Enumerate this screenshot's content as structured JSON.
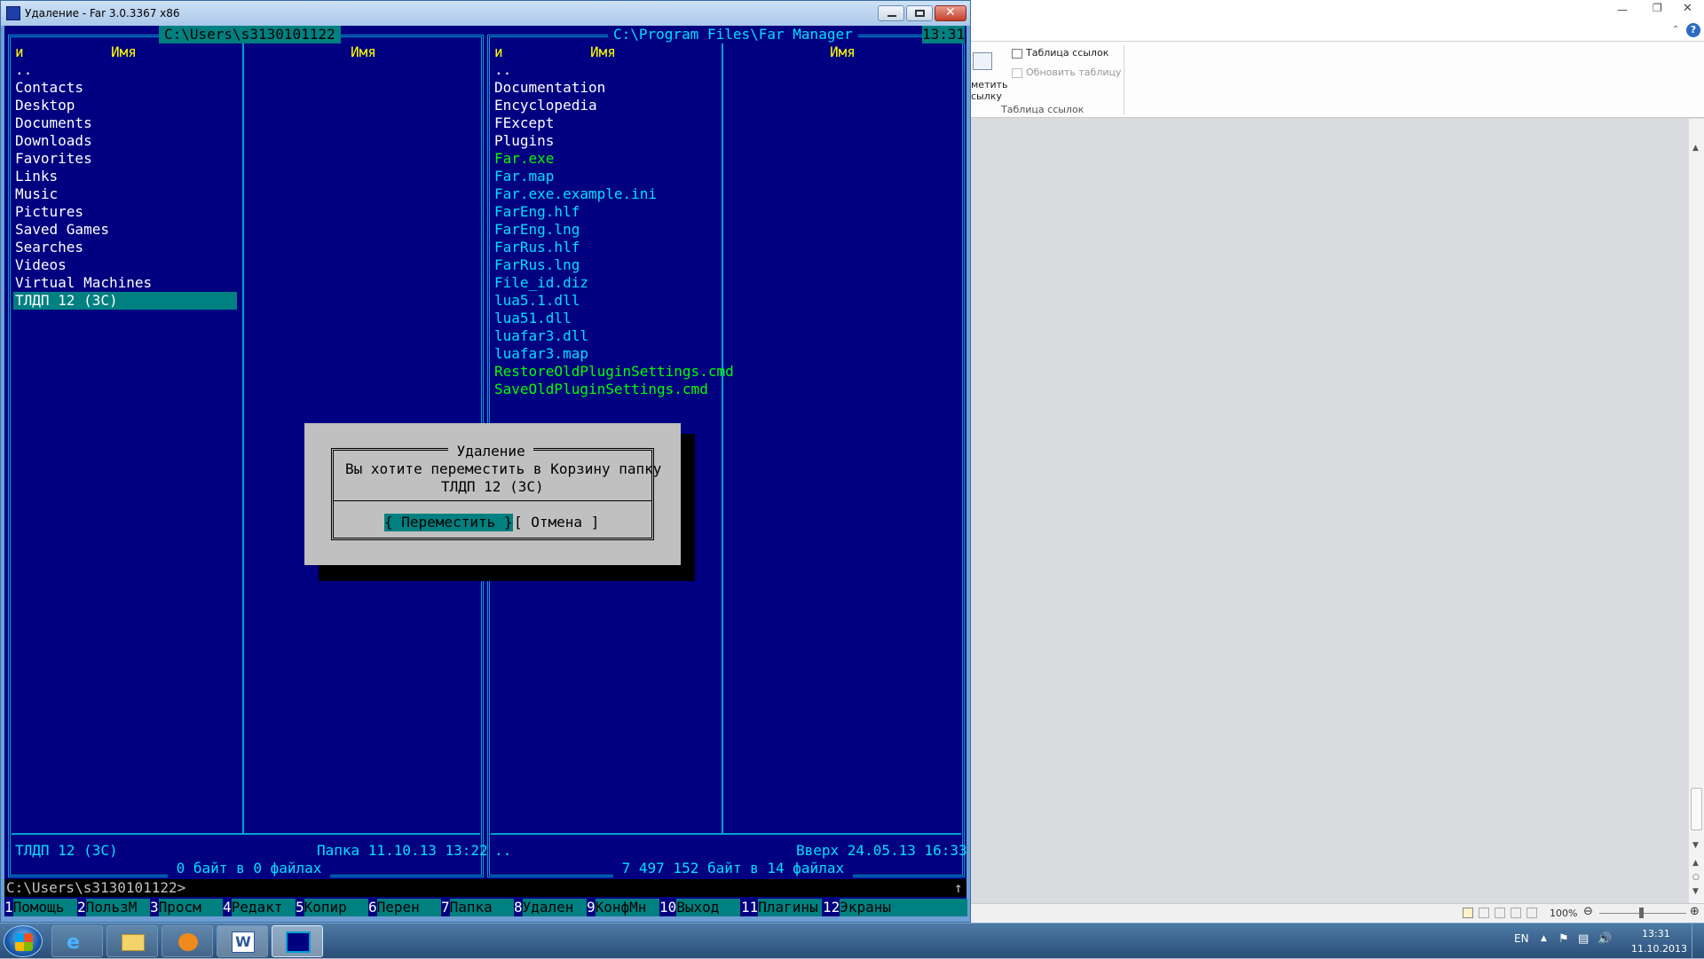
{
  "far": {
    "window_title": "Удаление - Far 3.0.3367 x86",
    "left_path": "C:\\Users\\s3130101122",
    "right_path": "C:\\Program Files\\Far Manager",
    "clock": "13:31",
    "col_left_short": "и",
    "col_name": "Имя",
    "left_files": [
      "..",
      "Contacts",
      "Desktop",
      "Documents",
      "Downloads",
      "Favorites",
      "Links",
      "Music",
      "Pictures",
      "Saved Games",
      "Searches",
      "Videos",
      "Virtual Machines",
      "ТЛДП 12 (3С)"
    ],
    "right_files": [
      {
        "name": "..",
        "kind": "dir"
      },
      {
        "name": "Documentation",
        "kind": "dir"
      },
      {
        "name": "Encyclopedia",
        "kind": "dir"
      },
      {
        "name": "FExcept",
        "kind": "dir"
      },
      {
        "name": "Plugins",
        "kind": "dir"
      },
      {
        "name": "Far.exe",
        "kind": "exe"
      },
      {
        "name": "Far.map",
        "kind": "file"
      },
      {
        "name": "Far.exe.example.ini",
        "kind": "file"
      },
      {
        "name": "FarEng.hlf",
        "kind": "file"
      },
      {
        "name": "FarEng.lng",
        "kind": "file"
      },
      {
        "name": "FarRus.hlf",
        "kind": "file"
      },
      {
        "name": "FarRus.lng",
        "kind": "file"
      },
      {
        "name": "File_id.diz",
        "kind": "file"
      },
      {
        "name": "lua5.1.dll",
        "kind": "file"
      },
      {
        "name": "lua51.dll",
        "kind": "file"
      },
      {
        "name": "luafar3.dll",
        "kind": "file"
      },
      {
        "name": "luafar3.map",
        "kind": "file"
      },
      {
        "name": "RestoreOldPluginSettings.cmd",
        "kind": "exe"
      },
      {
        "name": "SaveOldPluginSettings.cmd",
        "kind": "exe"
      }
    ],
    "left_status_name": "ТЛДП 12 (3С)",
    "left_status_info": "Папка 11.10.13 13:22",
    "left_summary": " 0 байт в 0 файлах ",
    "right_status_name": "..",
    "right_status_info": "Вверх 24.05.13 16:33",
    "right_summary": " 7 497 152 байт в 14 файлах ",
    "command_line": "C:\\Users\\s3130101122>",
    "scroll_arrow": "↑",
    "dialog": {
      "title": " Удаление ",
      "message_line1": "Вы хотите переместить в Корзину папку",
      "message_line2": "ТЛДП 12 (3С)",
      "button_move": "{ Переместить }",
      "button_cancel": "[ Отмена ]"
    },
    "keybar": [
      {
        "num": "1",
        "label": "Помощь"
      },
      {
        "num": "2",
        "label": "ПользМ"
      },
      {
        "num": "3",
        "label": "Просм"
      },
      {
        "num": "4",
        "label": "Редакт"
      },
      {
        "num": "5",
        "label": "Копир"
      },
      {
        "num": "6",
        "label": "Перен"
      },
      {
        "num": "7",
        "label": "Папка"
      },
      {
        "num": "8",
        "label": "Удален"
      },
      {
        "num": "9",
        "label": "КонфМн"
      },
      {
        "num": "10",
        "label": "Выход"
      },
      {
        "num": "11",
        "label": "Плагины"
      },
      {
        "num": "12",
        "label": "Экраны"
      }
    ]
  },
  "word": {
    "ribbon_btn1": "Таблица ссылок",
    "ribbon_btn2": "Обновить таблицу",
    "ribbon_partial1": "метить",
    "ribbon_partial2": "сылку",
    "ribbon_group": "Таблица ссылок",
    "zoom": "100%"
  },
  "taskbar": {
    "lang": "EN",
    "time": "13:31",
    "date": "11.10.2013"
  },
  "colors": {
    "console_bg": "#000080",
    "frame": "#00a0d0",
    "header": "#ffff00",
    "exe": "#00ff00",
    "selection": "#008080"
  }
}
